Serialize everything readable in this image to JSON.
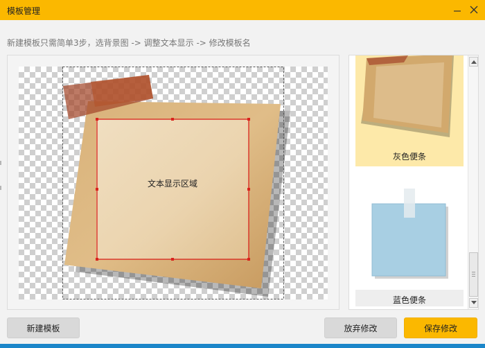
{
  "window": {
    "title": "模板管理",
    "accent_color": "#fbb800",
    "bottom_bar_color": "#1b86c9"
  },
  "hint_text": "新建模板只需简单3步，选背景图 -> 调整文本显示 -> 修改模板名",
  "editor": {
    "text_area_label": "文本显示区域",
    "selection_color": "#d9231c"
  },
  "templates": [
    {
      "label": "灰色便条",
      "selected": true,
      "thumb": "tan-sticky-note-image"
    },
    {
      "label": "蓝色便条",
      "selected": false,
      "thumb": "blue-sticky-note-image"
    }
  ],
  "buttons": {
    "new_template": "新建模板",
    "discard_changes": "放弃修改",
    "save_changes": "保存修改"
  },
  "icons": {
    "minimize": "minimize-icon",
    "close": "close-icon",
    "scroll_up": "chevron-up-icon",
    "scroll_down": "chevron-down-icon"
  }
}
